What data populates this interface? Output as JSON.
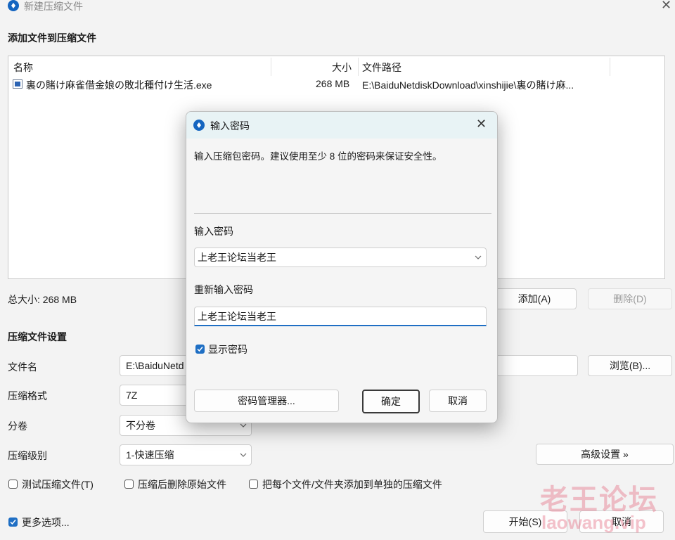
{
  "window": {
    "title": "新建压缩文件",
    "close_glyph": "✕"
  },
  "files_section": {
    "title": "添加文件到压缩文件",
    "columns": {
      "name": "名称",
      "size": "大小",
      "path": "文件路径"
    },
    "rows": [
      {
        "name": "裏の賭け麻雀借金娘の敗北種付け生活.exe",
        "size": "268 MB",
        "path": "E:\\BaiduNetdiskDownload\\xinshijie\\裏の賭け麻..."
      }
    ],
    "total_size": "总大小: 268 MB",
    "add_label": "添加(A)",
    "delete_label": "删除(D)"
  },
  "settings": {
    "title": "压缩文件设置",
    "filename_label": "文件名",
    "filename_value": "E:\\BaiduNetd",
    "browse_label": "浏览(B)...",
    "format_label": "压缩格式",
    "format_value": "7Z",
    "split_label": "分卷",
    "split_value": "不分卷",
    "level_label": "压缩级别",
    "level_value": "1-快速压缩",
    "advanced_label": "高级设置 »",
    "test_label": "测试压缩文件(T)",
    "test_checked": false,
    "delete_after_label": "压缩后删除原始文件",
    "delete_after_checked": false,
    "separate_label": "把每个文件/文件夹添加到单独的压缩文件",
    "separate_checked": false
  },
  "footer": {
    "more_options_label": "更多选项...",
    "more_options_checked": true,
    "start_label": "开始(S)",
    "cancel_label": "取消"
  },
  "dialog": {
    "title": "输入密码",
    "close_glyph": "✕",
    "description": "输入压缩包密码。建议使用至少 8 位的密码来保证安全性。",
    "password_label": "输入密码",
    "password_value": "上老王论坛当老王",
    "confirm_label": "重新输入密码",
    "confirm_value": "上老王论坛当老王",
    "show_password_label": "显示密码",
    "show_password_checked": true,
    "manager_label": "密码管理器...",
    "ok_label": "确定",
    "cancel_label": "取消"
  },
  "watermark": {
    "text_cn": "老王论坛",
    "text_en": "laowang.vip"
  },
  "colors": {
    "accent": "#1f6fc4",
    "dialog_titlebar": "#e8f3f5",
    "window_bg": "#f3f3f3"
  }
}
